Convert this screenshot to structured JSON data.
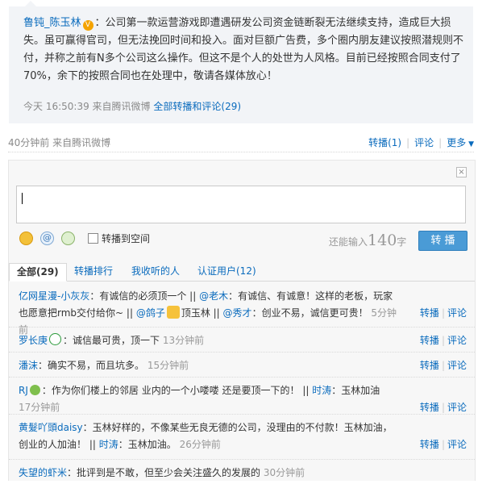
{
  "quote": {
    "author": "鲁钝_陈玉林",
    "text": "：公司第一款运营游戏即遭遇研发公司资金链断裂无法继续支持，造成巨大损失。虽可赢得官司，但无法挽回时间和投入。面对巨额广告费，多个圈内朋友建议按照潜规则不付，并称之前有N多个公司这么操作。但这不是个人的处世为人风格。目前已经按照合同支付了70%，余下的按照合同也在处理中，敬请各媒体放心！",
    "time": "今天 16:50:39",
    "source": "来自腾讯微博",
    "all_link": "全部转播和评论(29)"
  },
  "post_meta": {
    "time": "40分钟前",
    "source": "来自腾讯微博",
    "repost": "转播(1)",
    "comment": "评论",
    "more": "更多"
  },
  "composer": {
    "checkbox_label": "转播到空间",
    "remain_prefix": "还能输入",
    "remain_count": "140",
    "remain_suffix": "字",
    "submit": "转 播"
  },
  "tabs": [
    {
      "label": "全部(29)"
    },
    {
      "label": "转播排行"
    },
    {
      "label": "我收听的人"
    },
    {
      "label": "认证用户(12)"
    }
  ],
  "actions": {
    "repost": "转播",
    "comment": "评论"
  },
  "items": [
    {
      "nick": "亿网星漫-小灰灰",
      "t1": "：有诚信的必须顶一个 || ",
      "n2": "@老木",
      "t2": "：有诚信、有诚意！这样的老板，玩家也愿意把rmb交付给你~ || ",
      "n3": "@鸽子",
      "t3": "顶玉林 || ",
      "n4": "@秀才",
      "t4": "：创业不易，诚信更可贵！",
      "time": "5分钟前"
    },
    {
      "nick": "罗长庚",
      "text": "：诚信最可贵，顶一下",
      "time": "13分钟前"
    },
    {
      "nick": "潘沫",
      "text": "：确实不易，而且坑多。",
      "time": "15分钟前"
    },
    {
      "nick": "RJ",
      "t1": "：作为你们楼上的邻居 业内的一个小喽喽 还是要顶一下的！ || ",
      "n2": "时涛",
      "t2": "：玉林加油",
      "time": "17分钟前"
    },
    {
      "nick": "黄髮吖頭daisy",
      "t1": "：玉林好样的，不像某些无良无德的公司，没理由的不付款！玉林加油，创业的人加油！ || ",
      "n2": "时涛",
      "t2": "：玉林加油。",
      "time": "26分钟前"
    },
    {
      "nick": "失望的虾米",
      "text": "：批评到是不敢，但至少会关注盛久的发展的",
      "time": "30分钟前"
    }
  ]
}
